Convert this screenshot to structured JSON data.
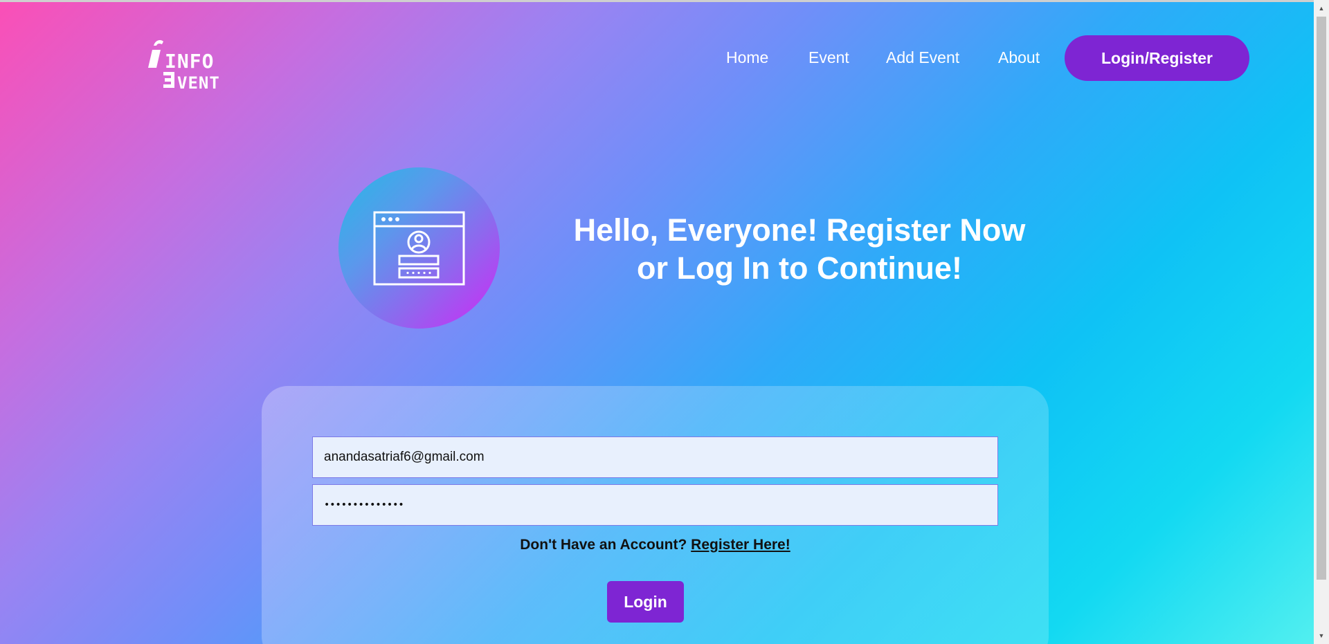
{
  "header": {
    "logo": {
      "line1": "INFO",
      "line2": "EVENT"
    },
    "nav": [
      {
        "label": "Home"
      },
      {
        "label": "Event"
      },
      {
        "label": "Add Event"
      },
      {
        "label": "About"
      }
    ],
    "cta_label": "Login/Register"
  },
  "hero": {
    "icon": "login-window-icon",
    "title_line1": "Hello, Everyone! Register Now",
    "title_line2": "or Log In to Continue!"
  },
  "form": {
    "email_value": "anandasatriaf6@gmail.com",
    "password_value": "••••••••••••••",
    "signup_prompt": "Don't Have an Account?",
    "signup_link": "Register Here!",
    "login_label": "Login"
  },
  "colors": {
    "accent": "#7e25d3",
    "field_bg": "#e8f0fd",
    "text_white": "#ffffff"
  }
}
